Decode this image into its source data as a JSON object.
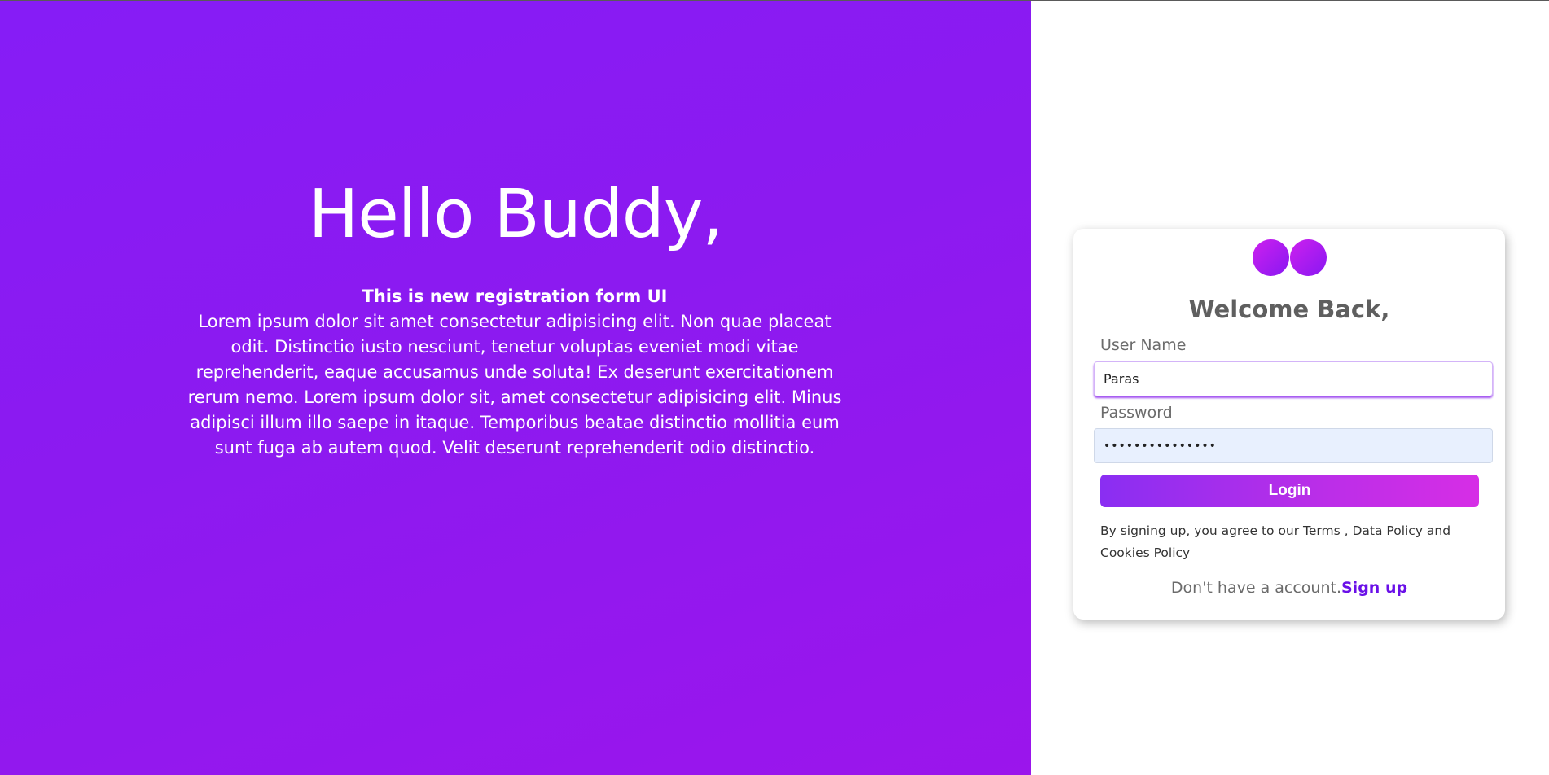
{
  "hero": {
    "title": "Hello Buddy,",
    "subtitle": "This is new registration form UI",
    "body": "Lorem ipsum dolor sit amet consectetur adipisicing elit. Non quae placeat odit. Distinctio iusto nesciunt, tenetur voluptas eveniet modi vitae reprehenderit, eaque accusamus unde soluta! Ex deserunt exercitationem rerum nemo. Lorem ipsum dolor sit, amet consectetur adipisicing elit. Minus adipisci illum illo saepe in itaque. Temporibus beatae distinctio mollitia eum sunt fuga ab autem quod. Velit deserunt reprehenderit odio distinctio."
  },
  "login": {
    "welcome": "Welcome Back,",
    "username_label": "User Name",
    "username_value": "Paras",
    "password_label": "Password",
    "password_value": "•••••••••••••••",
    "button_label": "Login",
    "policy_text": "By signing up, you agree to our Terms , Data Policy and Cookies Policy",
    "signup_prompt": "Don't have a account.",
    "signup_link": "Sign up"
  },
  "colors": {
    "hero_gradient_start": "#861cf6",
    "hero_gradient_end": "#9b15ec",
    "accent": "#6a10e8",
    "button_gradient_start": "#8a2ef2",
    "button_gradient_end": "#d62ee6"
  },
  "icons": {
    "logo": "two-circles-logo-icon"
  }
}
